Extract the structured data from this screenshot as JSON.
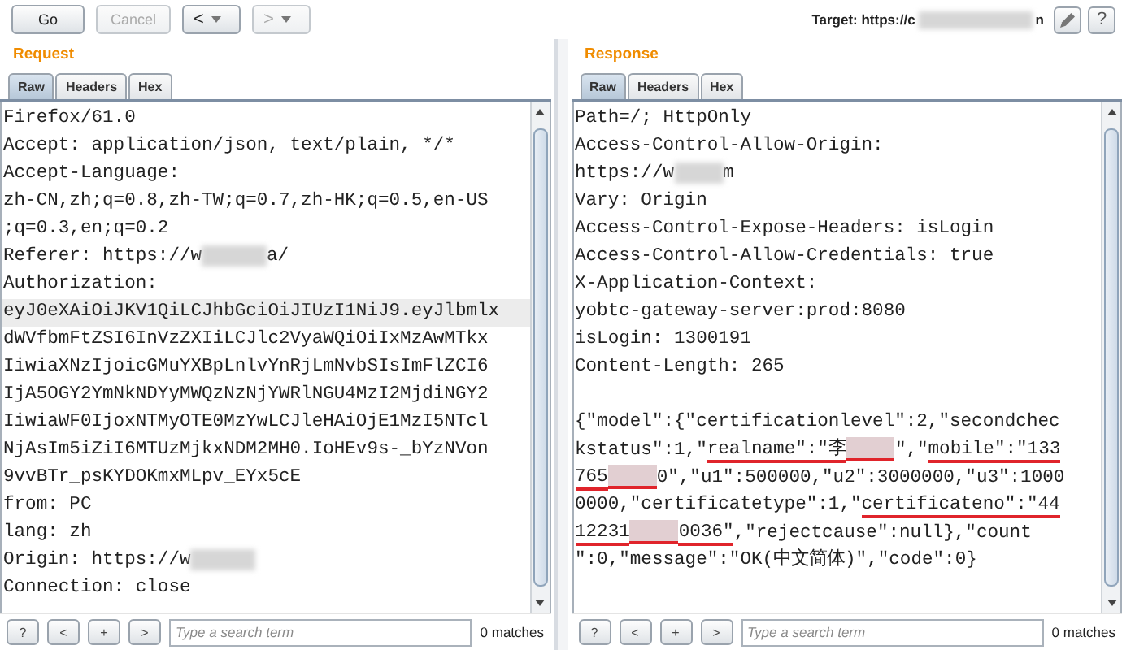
{
  "toolbar": {
    "buttons": [
      {
        "label": "Go",
        "disabled": false
      },
      {
        "label": "Cancel",
        "disabled": true
      }
    ],
    "history": [
      {
        "label": "<",
        "disabled": false
      },
      {
        "label": ">",
        "disabled": true
      }
    ],
    "target": {
      "label": "Target: https://c",
      "tail": "n"
    },
    "help": "?"
  },
  "panes": [
    {
      "title": "Request",
      "tabs": [
        {
          "label": "Raw",
          "selected": true
        },
        {
          "label": "Headers",
          "selected": false
        },
        {
          "label": "Hex",
          "selected": false
        }
      ],
      "lines": [
        {
          "kind": "text",
          "highlighted": false,
          "segments": [
            {
              "kind": "text",
              "text": "Firefox/61.0",
              "underlined": false
            }
          ]
        },
        {
          "kind": "text",
          "highlighted": false,
          "segments": [
            {
              "kind": "text",
              "text": "Accept: application/json, text/plain, */*",
              "underlined": false
            }
          ]
        },
        {
          "kind": "text",
          "highlighted": false,
          "segments": [
            {
              "kind": "text",
              "text": "Accept-Language:",
              "underlined": false
            }
          ]
        },
        {
          "kind": "text",
          "highlighted": false,
          "segments": [
            {
              "kind": "text",
              "text": "zh-CN,zh;q=0.8,zh-TW;q=0.7,zh-HK;q=0.5,en-US",
              "underlined": false
            }
          ]
        },
        {
          "kind": "text",
          "highlighted": false,
          "segments": [
            {
              "kind": "text",
              "text": ";q=0.3,en;q=0.2",
              "underlined": false
            }
          ]
        },
        {
          "kind": "text",
          "highlighted": false,
          "segments": [
            {
              "kind": "text",
              "text": "Referer: https://w",
              "underlined": false
            },
            {
              "kind": "redacted",
              "underlined": false
            },
            {
              "kind": "text",
              "text": "a/",
              "underlined": false
            }
          ]
        },
        {
          "kind": "text",
          "highlighted": false,
          "segments": [
            {
              "kind": "text",
              "text": "Authorization:",
              "underlined": false
            }
          ]
        },
        {
          "kind": "text",
          "highlighted": true,
          "segments": [
            {
              "kind": "text",
              "text": "eyJ0eXAiOiJKV1QiLCJhbGciOiJIUzI1NiJ9.eyJlbmlx",
              "underlined": false
            }
          ]
        },
        {
          "kind": "text",
          "highlighted": false,
          "segments": [
            {
              "kind": "text",
              "text": "dWVfbmFtZSI6InVzZXIiLCJlc2VyaWQiOiIxMzAwMTkx",
              "underlined": false
            }
          ]
        },
        {
          "kind": "text",
          "highlighted": false,
          "segments": [
            {
              "kind": "text",
              "text": "IiwiaXNzIjoicGMuYXBpLnlvYnRjLmNvbSIsImFlZCI6",
              "underlined": false
            }
          ]
        },
        {
          "kind": "text",
          "highlighted": false,
          "segments": [
            {
              "kind": "text",
              "text": "IjA5OGY2YmNkNDYyMWQzNzNjYWRlNGU4MzI2MjdiNGY2",
              "underlined": false
            }
          ]
        },
        {
          "kind": "text",
          "highlighted": false,
          "segments": [
            {
              "kind": "text",
              "text": "IiwiaWF0IjoxNTMyOTE0MzYwLCJleHAiOjE1MzI5NTcl",
              "underlined": false
            }
          ]
        },
        {
          "kind": "text",
          "highlighted": false,
          "segments": [
            {
              "kind": "text",
              "text": "NjAsIm5iZiI6MTUzMjkxNDM2MH0.IoHEv9s-_bYzNVon",
              "underlined": false
            }
          ]
        },
        {
          "kind": "text",
          "highlighted": false,
          "segments": [
            {
              "kind": "text",
              "text": "9vvBTr_psKYDOKmxMLpv_EYx5cE",
              "underlined": false
            }
          ]
        },
        {
          "kind": "text",
          "highlighted": false,
          "segments": [
            {
              "kind": "text",
              "text": "from: PC",
              "underlined": false
            }
          ]
        },
        {
          "kind": "text",
          "highlighted": false,
          "segments": [
            {
              "kind": "text",
              "text": "lang: zh",
              "underlined": false
            }
          ]
        },
        {
          "kind": "text",
          "highlighted": false,
          "segments": [
            {
              "kind": "text",
              "text": "Origin: https://w",
              "underlined": false
            },
            {
              "kind": "redacted",
              "underlined": false
            }
          ]
        },
        {
          "kind": "text",
          "highlighted": false,
          "segments": [
            {
              "kind": "text",
              "text": "Connection: close",
              "underlined": false
            }
          ]
        }
      ],
      "search": {
        "buttons": [
          "?",
          "<",
          "+",
          ">"
        ],
        "placeholder": "Type a search term",
        "matches": "0 matches"
      }
    },
    {
      "title": "Response",
      "tabs": [
        {
          "label": "Raw",
          "selected": true
        },
        {
          "label": "Headers",
          "selected": false
        },
        {
          "label": "Hex",
          "selected": false
        }
      ],
      "lines": [
        {
          "kind": "text",
          "highlighted": false,
          "segments": [
            {
              "kind": "text",
              "text": "Path=/; HttpOnly",
              "underlined": false
            }
          ]
        },
        {
          "kind": "text",
          "highlighted": false,
          "segments": [
            {
              "kind": "text",
              "text": "Access-Control-Allow-Origin:",
              "underlined": false
            }
          ]
        },
        {
          "kind": "text",
          "highlighted": false,
          "segments": [
            {
              "kind": "text",
              "text": "https://w",
              "underlined": false
            },
            {
              "kind": "redacted",
              "underlined": false
            },
            {
              "kind": "text",
              "text": "m",
              "underlined": false
            }
          ]
        },
        {
          "kind": "text",
          "highlighted": false,
          "segments": [
            {
              "kind": "text",
              "text": "Vary: Origin",
              "underlined": false
            }
          ]
        },
        {
          "kind": "text",
          "highlighted": false,
          "segments": [
            {
              "kind": "text",
              "text": "Access-Control-Expose-Headers: isLogin",
              "underlined": false
            }
          ]
        },
        {
          "kind": "text",
          "highlighted": false,
          "segments": [
            {
              "kind": "text",
              "text": "Access-Control-Allow-Credentials: true",
              "underlined": false
            }
          ]
        },
        {
          "kind": "text",
          "highlighted": false,
          "segments": [
            {
              "kind": "text",
              "text": "X-Application-Context:",
              "underlined": false
            }
          ]
        },
        {
          "kind": "text",
          "highlighted": false,
          "segments": [
            {
              "kind": "text",
              "text": "yobtc-gateway-server:prod:8080",
              "underlined": false
            }
          ]
        },
        {
          "kind": "text",
          "highlighted": false,
          "segments": [
            {
              "kind": "text",
              "text": "isLogin: 1300191",
              "underlined": false
            }
          ]
        },
        {
          "kind": "text",
          "highlighted": false,
          "segments": [
            {
              "kind": "text",
              "text": "Content-Length: 265",
              "underlined": false
            }
          ]
        },
        {
          "kind": "blank"
        },
        {
          "kind": "text",
          "highlighted": false,
          "segments": [
            {
              "kind": "text",
              "text": "{\"model\":{\"certificationlevel\":2,\"secondchec",
              "underlined": false
            }
          ]
        },
        {
          "kind": "text",
          "highlighted": false,
          "segments": [
            {
              "kind": "text",
              "text": "kstatus\":1,\"",
              "underlined": false
            },
            {
              "kind": "text",
              "text": "realname\":\"李",
              "underlined": true
            },
            {
              "kind": "redacted",
              "underlined": true
            },
            {
              "kind": "text",
              "text": "\",\"",
              "underlined": false
            },
            {
              "kind": "text",
              "text": "mobile\":\"133",
              "underlined": true
            }
          ]
        },
        {
          "kind": "text",
          "highlighted": false,
          "segments": [
            {
              "kind": "text",
              "text": "765",
              "underlined": true
            },
            {
              "kind": "redacted",
              "underlined": true
            },
            {
              "kind": "text",
              "text": "0\",\"u1\":500000,\"u2\":3000000,\"u3\":1000",
              "underlined": false
            }
          ]
        },
        {
          "kind": "text",
          "highlighted": false,
          "segments": [
            {
              "kind": "text",
              "text": "0000,\"certificatetype\":1,\"",
              "underlined": false
            },
            {
              "kind": "text",
              "text": "certificateno\":\"44",
              "underlined": true
            }
          ]
        },
        {
          "kind": "text",
          "highlighted": false,
          "segments": [
            {
              "kind": "text",
              "text": "12231",
              "underlined": true
            },
            {
              "kind": "redacted",
              "underlined": true
            },
            {
              "kind": "text",
              "text": "0036\"",
              "underlined": true
            },
            {
              "kind": "text",
              "text": ",\"rejectcause\":null},\"count",
              "underlined": false
            }
          ]
        },
        {
          "kind": "text",
          "highlighted": false,
          "segments": [
            {
              "kind": "text",
              "text": "\":0,\"message\":\"OK(中文简体)\",\"code\":0}",
              "underlined": false
            }
          ]
        }
      ],
      "search": {
        "buttons": [
          "?",
          "<",
          "+",
          ">"
        ],
        "placeholder": "Type a search term",
        "matches": "0 matches"
      }
    }
  ]
}
